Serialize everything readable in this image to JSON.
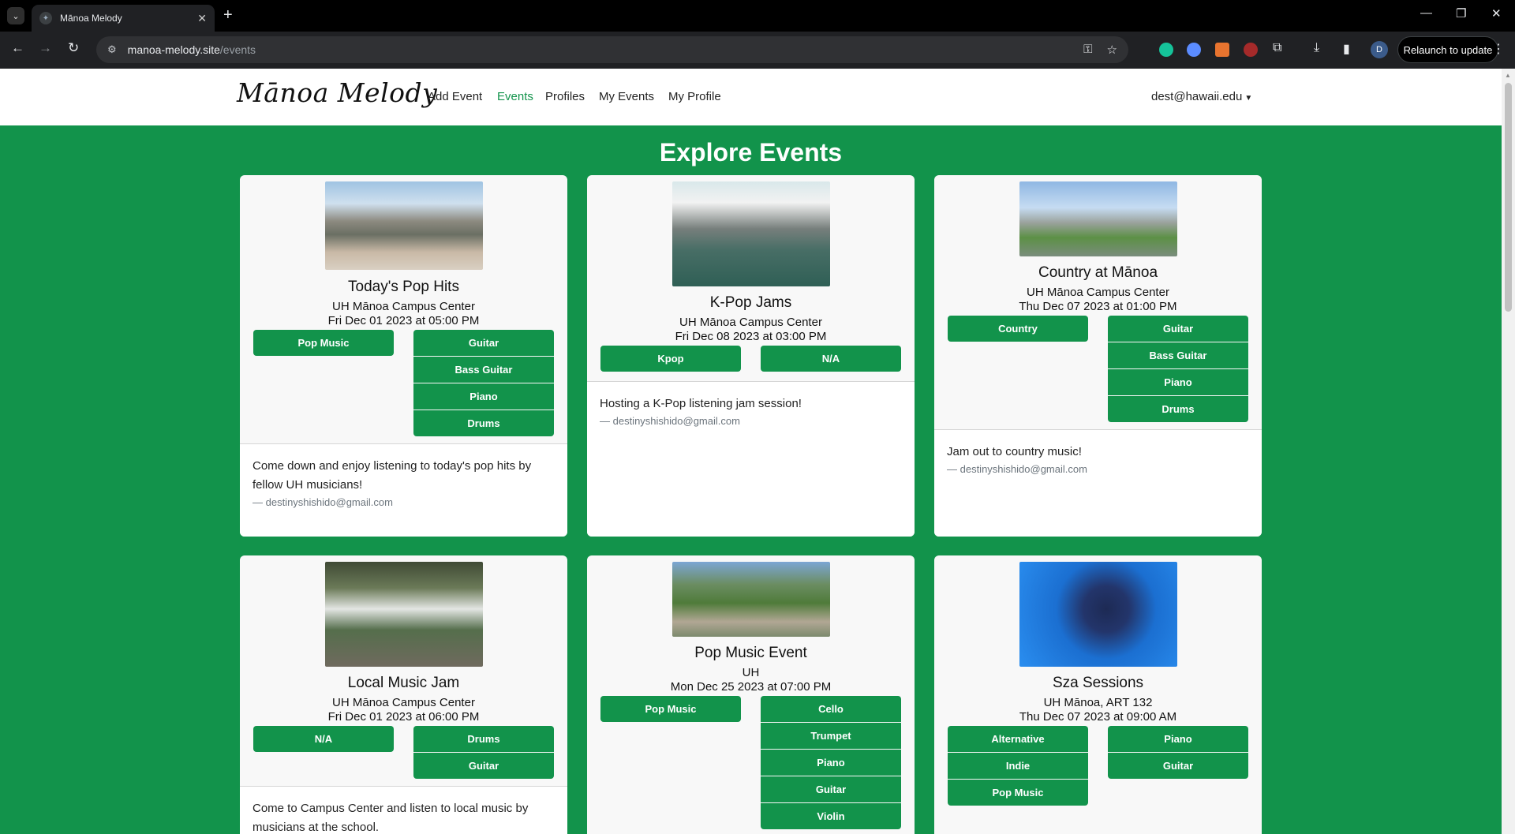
{
  "browser": {
    "tab_title": "Mānoa Melody",
    "url_host": "manoa-melody.site",
    "url_path": "/events",
    "avatar_letter": "D",
    "relaunch_label": "Relaunch to update"
  },
  "navbar": {
    "brand": "Mānoa Melody",
    "links": [
      "Add Event",
      "Events",
      "Profiles",
      "My Events",
      "My Profile"
    ],
    "active_link": "Events",
    "user": "dest@hawaii.edu"
  },
  "page": {
    "title": "Explore Events"
  },
  "events": [
    {
      "title": "Today's Pop Hits",
      "location": "UH Mānoa Campus Center",
      "date": "Fri Dec 01 2023 at 05:00 PM",
      "genres": [
        "Pop Music"
      ],
      "instruments": [
        "Guitar",
        "Bass Guitar",
        "Piano",
        "Drums"
      ],
      "description": "Come down and enjoy listening to today's pop hits by fellow UH musicians!",
      "owner": "— destinyshishido@gmail.com"
    },
    {
      "title": "K-Pop Jams",
      "location": "UH Mānoa Campus Center",
      "date": "Fri Dec 08 2023 at 03:00 PM",
      "genres": [
        "Kpop"
      ],
      "instruments": [
        "N/A"
      ],
      "description": "Hosting a K-Pop listening jam session!",
      "owner": "— destinyshishido@gmail.com"
    },
    {
      "title": "Country at Mānoa",
      "location": "UH Mānoa Campus Center",
      "date": "Thu Dec 07 2023 at 01:00 PM",
      "genres": [
        "Country"
      ],
      "instruments": [
        "Guitar",
        "Bass Guitar",
        "Piano",
        "Drums"
      ],
      "description": "Jam out to country music!",
      "owner": "— destinyshishido@gmail.com"
    },
    {
      "title": "Local Music Jam",
      "location": "UH Mānoa Campus Center",
      "date": "Fri Dec 01 2023 at 06:00 PM",
      "genres": [
        "N/A"
      ],
      "instruments": [
        "Drums",
        "Guitar"
      ],
      "description": "Come to Campus Center and listen to local music by musicians at the school.",
      "owner": ""
    },
    {
      "title": "Pop Music Event",
      "location": "UH",
      "date": "Mon Dec 25 2023 at 07:00 PM",
      "genres": [
        "Pop Music"
      ],
      "instruments": [
        "Cello",
        "Trumpet",
        "Piano",
        "Guitar",
        "Violin"
      ],
      "description": "",
      "owner": ""
    },
    {
      "title": "Sza Sessions",
      "location": "UH Mānoa, ART 132",
      "date": "Thu Dec 07 2023 at 09:00 AM",
      "genres": [
        "Alternative",
        "Indie",
        "Pop Music"
      ],
      "instruments": [
        "Piano",
        "Guitar"
      ],
      "description": "",
      "owner": ""
    }
  ],
  "colors": {
    "brand_green": "#12934b",
    "card_bg": "#f8f8f8"
  }
}
